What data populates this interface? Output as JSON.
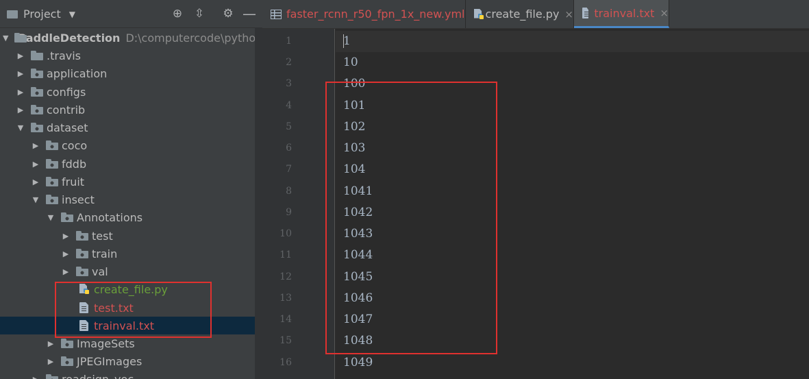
{
  "project_panel": {
    "title": "Project",
    "tree": [
      {
        "label": "PaddleDetection",
        "path": "D:\\computercode\\python\\Pa"
      },
      {
        "label": ".travis"
      },
      {
        "label": "application"
      },
      {
        "label": "configs"
      },
      {
        "label": "contrib"
      },
      {
        "label": "dataset"
      },
      {
        "label": "coco"
      },
      {
        "label": "fddb"
      },
      {
        "label": "fruit"
      },
      {
        "label": "insect"
      },
      {
        "label": "Annotations"
      },
      {
        "label": "test"
      },
      {
        "label": "train"
      },
      {
        "label": "val"
      },
      {
        "label": "create_file.py"
      },
      {
        "label": "test.txt"
      },
      {
        "label": "trainval.txt"
      },
      {
        "label": "ImageSets"
      },
      {
        "label": "JPEGImages"
      },
      {
        "label": "roadsign_voc"
      }
    ]
  },
  "tabs": [
    {
      "label": "faster_rcnn_r50_fpn_1x_new.yml",
      "icon": "yaml-file-icon",
      "close": "×"
    },
    {
      "label": "create_file.py",
      "icon": "python-file-icon",
      "close": "×"
    },
    {
      "label": "trainval.txt",
      "icon": "text-file-icon",
      "close": "×",
      "active": true
    }
  ],
  "editor": {
    "line_numbers": [
      "1",
      "2",
      "3",
      "4",
      "5",
      "6",
      "7",
      "8",
      "9",
      "10",
      "11",
      "12",
      "13",
      "14",
      "15",
      "16"
    ],
    "lines": [
      "1",
      "10",
      "100",
      "101",
      "102",
      "103",
      "104",
      "1041",
      "1042",
      "1043",
      "1044",
      "1045",
      "1046",
      "1047",
      "1048",
      "1049"
    ]
  },
  "colors": {
    "highlight_box": "#e0312f",
    "modified_file": "#d25252",
    "new_file": "#6a9f3a",
    "selection": "#0d293e"
  }
}
